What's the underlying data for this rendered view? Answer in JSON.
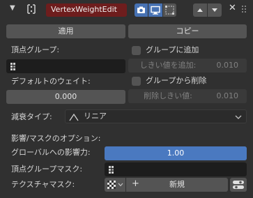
{
  "header": {
    "modifier_name": "VertexWeightEdit",
    "icons": [
      "collapse-arrow",
      "modifier-icon",
      "camera-icon",
      "monitor-icon",
      "editmode-icon",
      "move-up-icon",
      "move-down-icon",
      "close-icon",
      "drag-handle-icon"
    ]
  },
  "buttons": {
    "apply": "適用",
    "copy": "コピー"
  },
  "left": {
    "vertex_group_label": "頂点グループ:",
    "default_weight_label": "デフォルトのウェイト:",
    "default_weight_value": "0.000"
  },
  "right": {
    "add_to_group_label": "グループに追加",
    "add_threshold_label": "しきい値を追加:",
    "add_threshold_value": "0.010",
    "remove_from_group_label": "グループから削除",
    "remove_threshold_label": "削除しきい値:",
    "remove_threshold_value": "0.010"
  },
  "falloff": {
    "label": "減衰タイプ:",
    "value": "リニア"
  },
  "influence": {
    "section_label": "影響/マスクのオプション:",
    "global_influence_label": "グローバルへの影響力:",
    "global_influence_value": "1.00",
    "global_influence_fraction": 1.0,
    "vertex_group_mask_label": "頂点グループマスク:",
    "texture_mask_label": "テクスチャマスク:",
    "new_label": "新規"
  },
  "colors": {
    "name_field_bg": "#6e1d1d",
    "accent": "#4772b3",
    "slider_fill": "#4a79c0"
  }
}
